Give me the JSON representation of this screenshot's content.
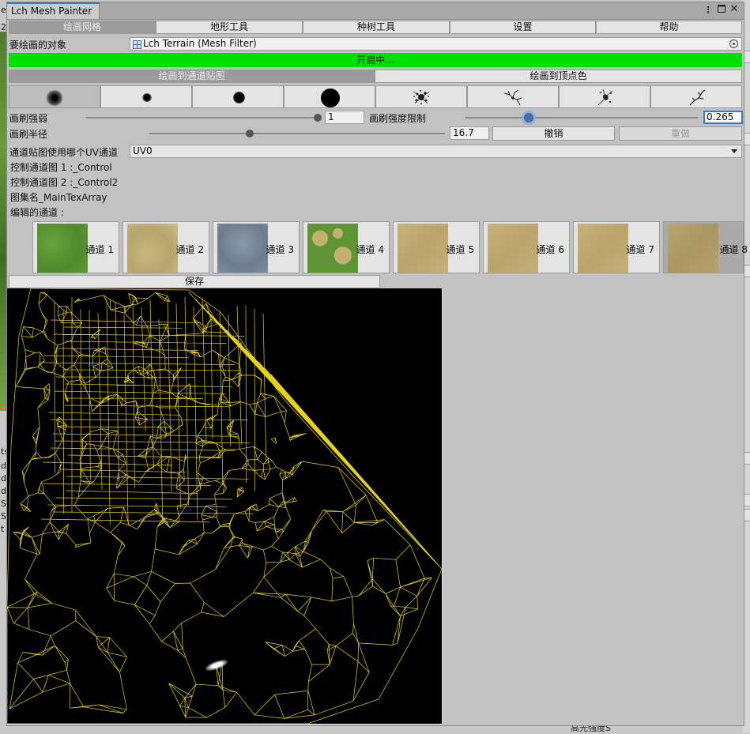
{
  "background": {
    "left_fragments": [
      "e",
      "2",
      "ts",
      "d",
      "d",
      "d",
      "S",
      "S",
      "t"
    ],
    "bottom_right_text": "高光强度S"
  },
  "window": {
    "title": "Lch Mesh Painter",
    "menu_icon": "kebab-icon",
    "maximize_icon": "maximize-icon",
    "close_icon": "close-icon"
  },
  "toolbar": {
    "tabs": [
      "绘画网格",
      "地形工具",
      "种树工具",
      "设置",
      "帮助"
    ],
    "active_index": 0
  },
  "target": {
    "label": "要绘画的对象",
    "value": "Lch Terrain (Mesh Filter)"
  },
  "status_bar": {
    "text": "开启中...",
    "color": "#00e000"
  },
  "paint_modes": {
    "tabs": [
      "绘画到通道贴图",
      "绘画到顶点色"
    ],
    "active_index": 0
  },
  "brushes": {
    "items": [
      "soft-brush-icon",
      "small-dot-brush-icon",
      "medium-dot-brush-icon",
      "large-dot-brush-icon",
      "splatter-brush-icon",
      "crack-brush-icon",
      "ink-brush-icon",
      "branch-brush-icon"
    ],
    "active_index": 0
  },
  "brush_strength": {
    "label": "画刷强弱",
    "value": "1",
    "fraction": 1.0
  },
  "brush_strength_limit": {
    "label": "画刷强度限制",
    "value": "0.265",
    "fraction": 0.265
  },
  "brush_radius": {
    "label": "画刷半径",
    "value": "16.7",
    "fraction": 0.3
  },
  "actions": {
    "undo": "撤销",
    "redo": "重做"
  },
  "uv_channel": {
    "label": "通道贴图使用哪个UV通道",
    "value": "UV0"
  },
  "info": {
    "control1": "控制通道图 1 :_Control",
    "control2": "控制通道图 2 :_Control2",
    "atlas": "图集名_MainTexArray",
    "edit_label": "编辑的通道 :"
  },
  "channels": {
    "items": [
      {
        "label": "通道 1",
        "texture": "grass"
      },
      {
        "label": "通道 2",
        "texture": "sand"
      },
      {
        "label": "通道 3",
        "texture": "rock"
      },
      {
        "label": "通道 4",
        "texture": "grass-patches"
      },
      {
        "label": "通道 5",
        "texture": "sand"
      },
      {
        "label": "通道 6",
        "texture": "sand"
      },
      {
        "label": "通道 7",
        "texture": "sand"
      },
      {
        "label": "通道 8",
        "texture": "sand"
      }
    ],
    "active_index": 7
  },
  "save_label": "保存",
  "preview": {
    "name": "uv-wireframe-preview",
    "line_color": "#e6d21a"
  }
}
